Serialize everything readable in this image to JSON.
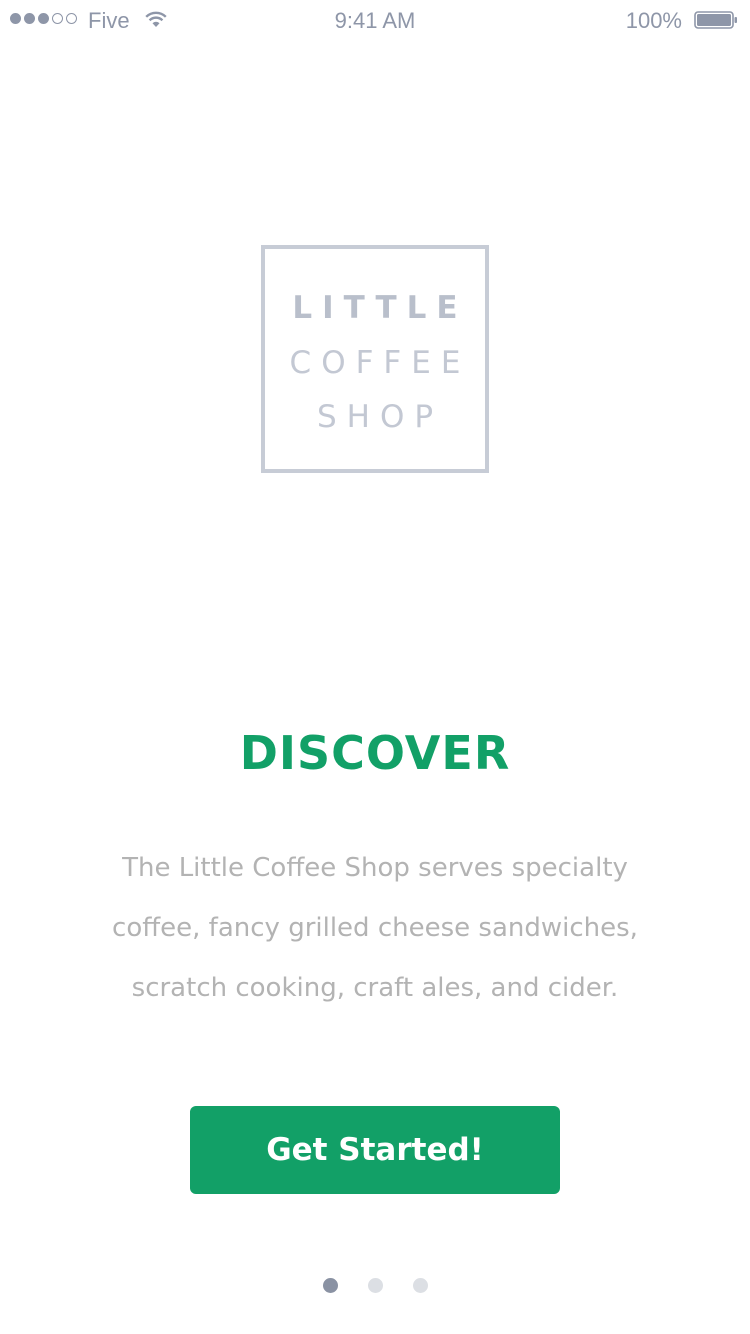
{
  "status_bar": {
    "signal_filled": 3,
    "signal_total": 5,
    "carrier": "Five",
    "time": "9:41 AM",
    "battery_text": "100%",
    "battery_level": 1.0
  },
  "logo": {
    "line1": "LITTLE",
    "line2": "COFFEE",
    "line3": "SHOP"
  },
  "headline": "DISCOVER",
  "description": "The Little Coffee Shop serves specialty coffee, fancy grilled cheese sandwiches, scratch cooking, craft ales, and cider.",
  "cta_label": "Get Started!",
  "pager": {
    "count": 3,
    "active_index": 0
  },
  "colors": {
    "accent": "#12a067",
    "status_gray": "#8e96a8",
    "logo_gray": "#c3c8d3",
    "body_text": "#b3b3b3",
    "dot_active": "#8a92a3",
    "dot_inactive": "#dcdfe4"
  },
  "icons": {
    "wifi": "wifi-icon",
    "battery": "battery-icon"
  }
}
